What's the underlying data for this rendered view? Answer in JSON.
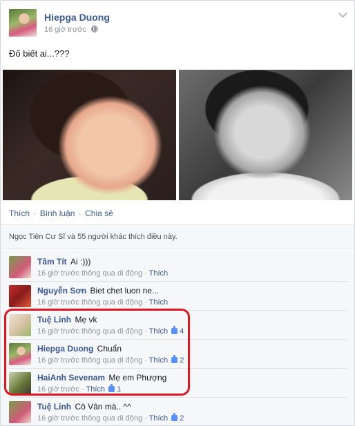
{
  "post": {
    "author": "Hiepga Duong",
    "time": "16 giờ trước",
    "text": "Đố biết ai...???",
    "actions": {
      "like": "Thích",
      "comment": "Bình luận",
      "share": "Chia sẻ",
      "separator": "·"
    },
    "likes_summary": "Ngọc Tiên Cư Sĩ và 55 người khác thích điều này."
  },
  "comments": [
    {
      "name": "Tâm Tít",
      "text": "Ai :)))",
      "meta": "16 giờ trước thông qua di động · ",
      "like_label": "Thích",
      "like_count": ""
    },
    {
      "name": "Nguyễn Sơn",
      "text": "Biet chet luon ne...",
      "meta": "16 giờ trước thông qua di động · ",
      "like_label": "Thích",
      "like_count": ""
    },
    {
      "name": "Tuệ Linh",
      "text": "Mẹ vk",
      "meta": "16 giờ trước thông qua di động · ",
      "like_label": "Thích",
      "like_count": "4"
    },
    {
      "name": "Hiepga Duong",
      "text": "Chuẩn",
      "meta": "16 giờ trước thông qua di động · ",
      "like_label": "Thích",
      "like_count": "2"
    },
    {
      "name": "HaiAnh Sevenam",
      "text": "Mẹ em Phượng",
      "meta": "16 giờ trước · ",
      "like_label": "Thích",
      "like_count": "1"
    },
    {
      "name": "Tuệ Linh",
      "text": "Cô Vân mà.. ^^",
      "meta": "16 giờ trước thông qua di động · ",
      "like_label": "Thích",
      "like_count": "2"
    }
  ],
  "colors": {
    "link": "#3b5998",
    "highlight": "#e2141f",
    "meta": "#90949c"
  },
  "icons": [
    "globe-icon",
    "chevron-down-icon",
    "thumbs-up-icon"
  ]
}
